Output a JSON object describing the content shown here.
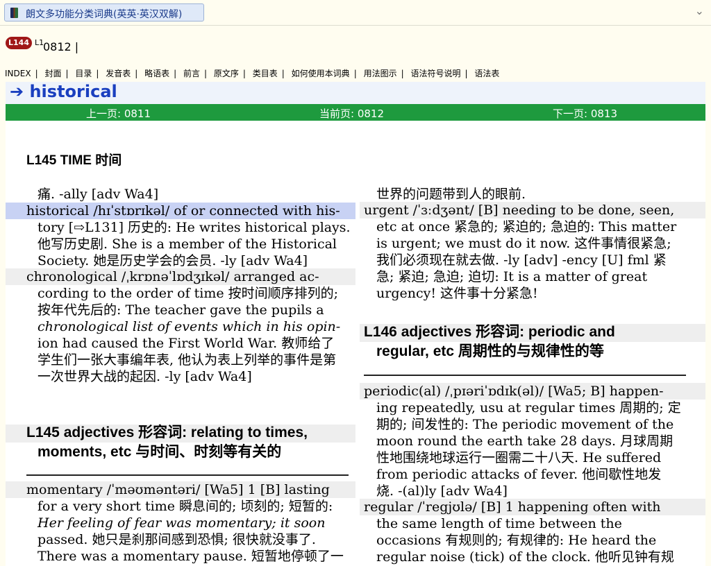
{
  "window": {
    "title": "朗文多功能分类词典(英英·英汉双解)",
    "menu_icon": "chevron-down-icon"
  },
  "page_tag": {
    "badge": "L144",
    "sup": "L1",
    "number": "0812 |"
  },
  "nav": [
    "INDEX",
    "封面",
    "目录",
    "发音表",
    "略语表",
    "前言",
    "原文序",
    "类目表",
    "如何使用本词典",
    "用法图示",
    "语法符号说明",
    "语法表"
  ],
  "nav_sep": "|",
  "headword": "➔ historical",
  "pager": {
    "prev": "上一页: 0811",
    "current": "当前页: 0812",
    "next": "下一页: 0813"
  },
  "colors": {
    "accent": "#1a3fbf",
    "pager_green": "#1e9a3e",
    "badge_red": "#a01818",
    "highlight": "#c8d2f4"
  },
  "scan": {
    "section_head": "L145 TIME  时间",
    "left": [
      "痛. -ally [adv Wa4]",
      "historical /hɪˈstɒrɪkəl/ of or connected with his-",
      "tory [⇨L131] 历史的: He writes historical plays.",
      "他写历史剧. She is a member of the Historical",
      "Society. 她是历史学会的会员. -ly [adv Wa4]",
      "chronological /ˌkrɒnəˈlɒdʒɪkəl/ arranged ac-",
      "cording to the order of time 按时间顺序排列的;",
      "按年代先后的: The teacher gave the pupils a",
      "chronological list of events which in his opin-",
      "ion had caused the First World War. 教师给了",
      "学生们一张大事编年表, 他认为表上列举的事件是第",
      "一次世界大战的起因. -ly [adv Wa4]",
      "L145 adjectives 形容词: relating to times,",
      "moments, etc 与时间、时刻等有关的",
      "momentary /ˈməʊməntəri/ [Wa5] 1 [B] lasting",
      "for a very short time 瞬息间的; 顷刻的; 短暂的:",
      "Her feeling of fear was momentary; it soon",
      "passed. 她只是刹那间感到恐惧; 很快就没事了.",
      "There was a momentary pause. 短暂地停顿了一"
    ],
    "right": [
      "世界的问题带到人的眼前.",
      "urgent /ˈɜːdʒənt/ [B] needing to be done, seen,",
      "etc at once 紧急的; 紧迫的; 急迫的: This matter",
      "is urgent; we must do it now. 这件事情很紧急;",
      "我们必须现在就去做. -ly [adv] -ency [U] fml 紧",
      "急; 紧迫; 急迫; 迫切: It is a matter of great",
      "urgency! 这件事十分紧急!",
      "L146 adjectives 形容词: periodic and",
      "regular, etc 周期性的与规律性的等",
      "periodic(al) /ˌpɪəriˈɒdɪk(əl)/ [Wa5; B] happen-",
      "ing repeatedly, usu at regular times 周期的; 定",
      "期的; 间发性的: The periodic movement of the",
      "moon round the earth take 28 days. 月球周期",
      "性地围绕地球运行一圈需二十八天. He suffered",
      "from periodic attacks of fever. 他间歇性地发",
      "烧. -(al)ly [adv Wa4]",
      "regular /ˈregjʊlə/ [B] 1 happening often with",
      "the same length of time between the",
      "occasions 有规则的; 有规律的: He heard the",
      "regular noise (tick) of the clock. 他听见钟有规"
    ]
  }
}
